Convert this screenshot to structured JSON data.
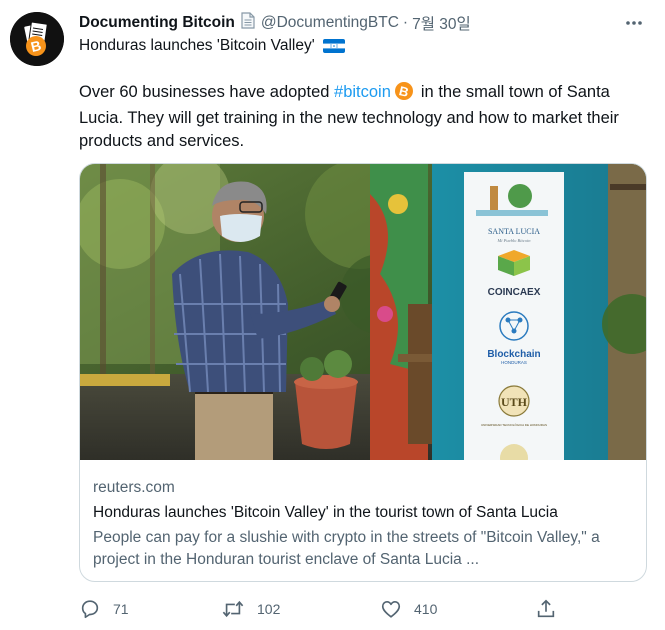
{
  "tweet": {
    "author": {
      "display_name": "Documenting Bitcoin",
      "handle": "@DocumentingBTC",
      "avatar_icon": "bitcoin-avatar-icon",
      "avatar_letter": "B"
    },
    "separator": "·",
    "date": "7월 30일",
    "more_icon": "more-horizontal-icon",
    "title": "Honduras launches 'Bitcoin Valley'",
    "flag_icon": "honduras-flag-icon",
    "text_before": "Over 60 businesses have adopted ",
    "hashtag": "#bitcoin",
    "hashtag_emoji": "bitcoin-emoji-icon",
    "text_after": "in the small town of Santa Lucia. They will get training in the new technology and how to market their products and services."
  },
  "card": {
    "image_icon": "news-photo",
    "banner": {
      "brand_1": "SANTA LUCIA",
      "brand_1_sub": "Mi Pueblo Bitcoin",
      "brand_2": "COINCAEX",
      "brand_3": "Blockchain",
      "brand_3_sub": "HONDURAS",
      "brand_4": "UTH",
      "brand_4_sub": "UNIVERSIDAD TECNOLÓGICA DE HONDURAS"
    },
    "domain": "reuters.com",
    "title": "Honduras launches 'Bitcoin Valley' in the tourist town of Santa Lucia",
    "description": "People can pay for a slushie with crypto in the streets of \"Bitcoin Valley,\" a project in the Honduran tourist enclave of Santa Lucia ..."
  },
  "actions": {
    "reply": {
      "icon": "reply-icon",
      "count": "71"
    },
    "retweet": {
      "icon": "retweet-icon",
      "count": "102"
    },
    "like": {
      "icon": "heart-icon",
      "count": "410"
    },
    "share": {
      "icon": "share-icon"
    }
  },
  "colors": {
    "accent": "#1d9bf0",
    "secondary_text": "#536471",
    "border": "#cfd9de",
    "bitcoin_orange": "#f7931a"
  }
}
